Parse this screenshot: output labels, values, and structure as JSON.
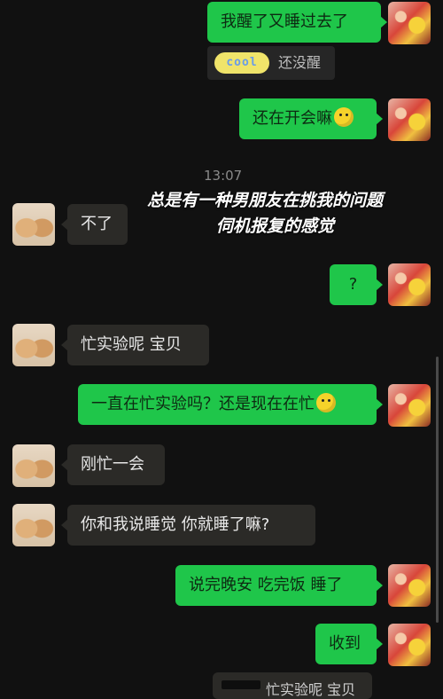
{
  "messages": [
    {
      "side": "me",
      "text": "我醒了又睡过去了"
    },
    {
      "side": "quote",
      "sticker": "cool",
      "text": "还没醒"
    },
    {
      "side": "me",
      "text": "还在开会嘛",
      "emoji": "thinking-face-emoji"
    },
    {
      "side": "timestamp",
      "text": "13:07"
    },
    {
      "side": "other",
      "text": "不了"
    },
    {
      "side": "me",
      "text": "?"
    },
    {
      "side": "other",
      "text": "忙实验呢  宝贝"
    },
    {
      "side": "me",
      "text": "一直在忙实验吗？还是现在在忙",
      "emoji": "thinking-face-emoji"
    },
    {
      "side": "other",
      "text": "刚忙一会"
    },
    {
      "side": "other",
      "text": "你和我说睡觉 你就睡了嘛?"
    },
    {
      "side": "me",
      "text": "说完晚安 吃完饭 睡了"
    },
    {
      "side": "me",
      "text": "收到"
    },
    {
      "side": "other",
      "text": "忙实验呢  宝贝"
    }
  ],
  "overlay": {
    "line1": "总是有一种男朋友在挑我的问题",
    "line2": "伺机报复的感觉"
  },
  "colors": {
    "background": "#111111",
    "my_bubble": "#1fc64a",
    "other_bubble": "#2b2a27"
  }
}
